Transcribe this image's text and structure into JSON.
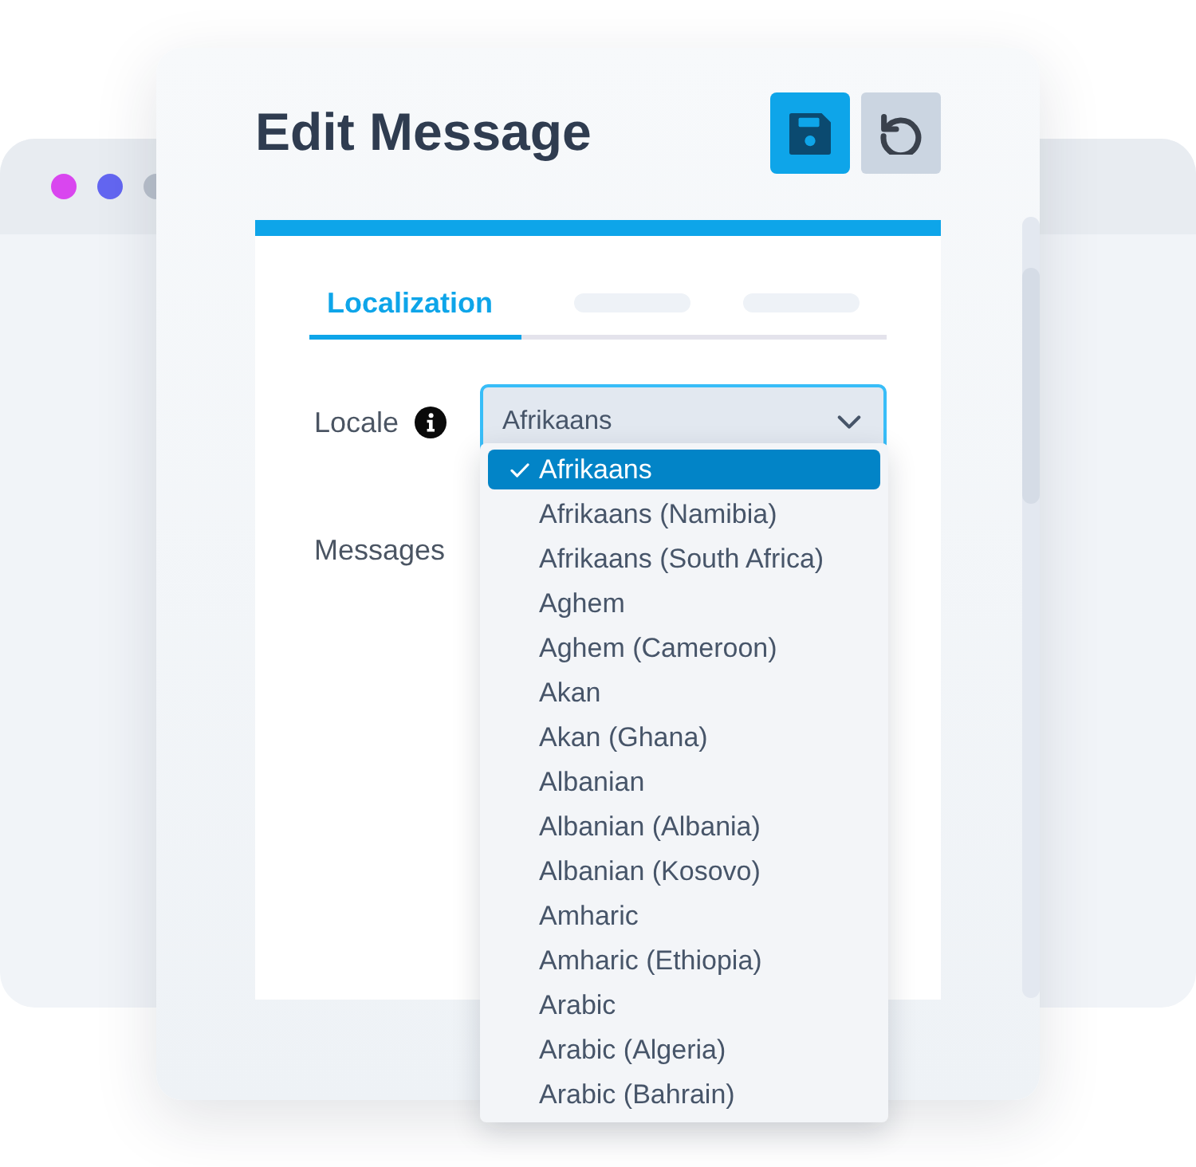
{
  "background_window": {
    "controls": [
      {
        "color": "#d946ef"
      },
      {
        "color": "#6366f1"
      },
      {
        "color": "#b9c1cc"
      }
    ]
  },
  "dialog": {
    "title": "Edit Message",
    "buttons": [
      {
        "kind": "save"
      },
      {
        "kind": "reset"
      }
    ]
  },
  "tabs": [
    {
      "kind": "text",
      "label": "Localization",
      "selected": true
    },
    {
      "kind": "skeleton",
      "selected": false
    },
    {
      "kind": "skeleton",
      "selected": false
    }
  ],
  "form": {
    "locale": {
      "label": "Locale",
      "value": "Afrikaans",
      "expanded": true,
      "options": [
        {
          "label": "Afrikaans",
          "selected": true
        },
        {
          "label": "Afrikaans (Namibia)",
          "selected": false
        },
        {
          "label": "Afrikaans (South Africa)",
          "selected": false
        },
        {
          "label": "Aghem",
          "selected": false
        },
        {
          "label": "Aghem (Cameroon)",
          "selected": false
        },
        {
          "label": "Akan",
          "selected": false
        },
        {
          "label": "Akan (Ghana)",
          "selected": false
        },
        {
          "label": "Albanian",
          "selected": false
        },
        {
          "label": "Albanian (Albania)",
          "selected": false
        },
        {
          "label": "Albanian (Kosovo)",
          "selected": false
        },
        {
          "label": "Amharic",
          "selected": false
        },
        {
          "label": "Amharic (Ethiopia)",
          "selected": false
        },
        {
          "label": "Arabic",
          "selected": false
        },
        {
          "label": "Arabic (Algeria)",
          "selected": false
        },
        {
          "label": "Arabic (Bahrain)",
          "selected": false
        }
      ]
    },
    "messages": {
      "label": "Messages"
    }
  }
}
